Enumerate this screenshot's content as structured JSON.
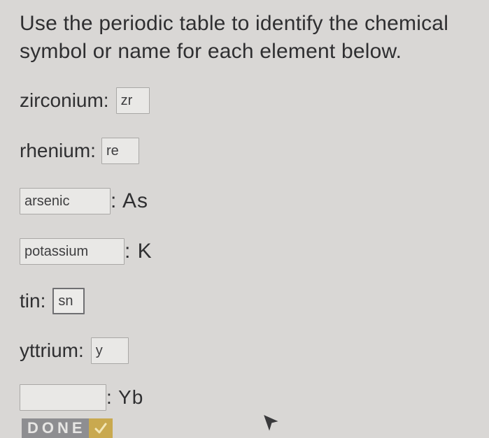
{
  "instructions": "Use the periodic table to identify the chemical symbol or name for each element below.",
  "questions": [
    {
      "prompt": "zirconium:",
      "answer": "zr",
      "placeholder": ""
    },
    {
      "prompt": "rhenium:",
      "answer": "re",
      "placeholder": ""
    },
    {
      "answer": "arsenic",
      "suffix": ": As"
    },
    {
      "answer": "potassium",
      "suffix": ": K"
    },
    {
      "prompt": "tin:",
      "answer": "sn"
    },
    {
      "prompt": "yttrium:",
      "answer": "y"
    },
    {
      "answer": "",
      "suffix": ": Yb"
    }
  ],
  "done_button": {
    "label": "DONE",
    "check_icon": "checkmark-icon",
    "color": "#8e8e91",
    "check_color": "#c9a94f"
  }
}
